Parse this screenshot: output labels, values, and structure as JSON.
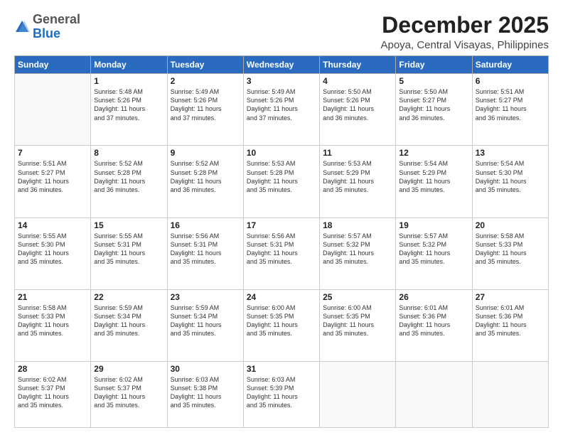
{
  "logo": {
    "general": "General",
    "blue": "Blue"
  },
  "title": "December 2025",
  "location": "Apoya, Central Visayas, Philippines",
  "days_header": [
    "Sunday",
    "Monday",
    "Tuesday",
    "Wednesday",
    "Thursday",
    "Friday",
    "Saturday"
  ],
  "weeks": [
    [
      {
        "day": "",
        "info": ""
      },
      {
        "day": "1",
        "info": "Sunrise: 5:48 AM\nSunset: 5:26 PM\nDaylight: 11 hours\nand 37 minutes."
      },
      {
        "day": "2",
        "info": "Sunrise: 5:49 AM\nSunset: 5:26 PM\nDaylight: 11 hours\nand 37 minutes."
      },
      {
        "day": "3",
        "info": "Sunrise: 5:49 AM\nSunset: 5:26 PM\nDaylight: 11 hours\nand 37 minutes."
      },
      {
        "day": "4",
        "info": "Sunrise: 5:50 AM\nSunset: 5:26 PM\nDaylight: 11 hours\nand 36 minutes."
      },
      {
        "day": "5",
        "info": "Sunrise: 5:50 AM\nSunset: 5:27 PM\nDaylight: 11 hours\nand 36 minutes."
      },
      {
        "day": "6",
        "info": "Sunrise: 5:51 AM\nSunset: 5:27 PM\nDaylight: 11 hours\nand 36 minutes."
      }
    ],
    [
      {
        "day": "7",
        "info": "Sunrise: 5:51 AM\nSunset: 5:27 PM\nDaylight: 11 hours\nand 36 minutes."
      },
      {
        "day": "8",
        "info": "Sunrise: 5:52 AM\nSunset: 5:28 PM\nDaylight: 11 hours\nand 36 minutes."
      },
      {
        "day": "9",
        "info": "Sunrise: 5:52 AM\nSunset: 5:28 PM\nDaylight: 11 hours\nand 36 minutes."
      },
      {
        "day": "10",
        "info": "Sunrise: 5:53 AM\nSunset: 5:28 PM\nDaylight: 11 hours\nand 35 minutes."
      },
      {
        "day": "11",
        "info": "Sunrise: 5:53 AM\nSunset: 5:29 PM\nDaylight: 11 hours\nand 35 minutes."
      },
      {
        "day": "12",
        "info": "Sunrise: 5:54 AM\nSunset: 5:29 PM\nDaylight: 11 hours\nand 35 minutes."
      },
      {
        "day": "13",
        "info": "Sunrise: 5:54 AM\nSunset: 5:30 PM\nDaylight: 11 hours\nand 35 minutes."
      }
    ],
    [
      {
        "day": "14",
        "info": "Sunrise: 5:55 AM\nSunset: 5:30 PM\nDaylight: 11 hours\nand 35 minutes."
      },
      {
        "day": "15",
        "info": "Sunrise: 5:55 AM\nSunset: 5:31 PM\nDaylight: 11 hours\nand 35 minutes."
      },
      {
        "day": "16",
        "info": "Sunrise: 5:56 AM\nSunset: 5:31 PM\nDaylight: 11 hours\nand 35 minutes."
      },
      {
        "day": "17",
        "info": "Sunrise: 5:56 AM\nSunset: 5:31 PM\nDaylight: 11 hours\nand 35 minutes."
      },
      {
        "day": "18",
        "info": "Sunrise: 5:57 AM\nSunset: 5:32 PM\nDaylight: 11 hours\nand 35 minutes."
      },
      {
        "day": "19",
        "info": "Sunrise: 5:57 AM\nSunset: 5:32 PM\nDaylight: 11 hours\nand 35 minutes."
      },
      {
        "day": "20",
        "info": "Sunrise: 5:58 AM\nSunset: 5:33 PM\nDaylight: 11 hours\nand 35 minutes."
      }
    ],
    [
      {
        "day": "21",
        "info": "Sunrise: 5:58 AM\nSunset: 5:33 PM\nDaylight: 11 hours\nand 35 minutes."
      },
      {
        "day": "22",
        "info": "Sunrise: 5:59 AM\nSunset: 5:34 PM\nDaylight: 11 hours\nand 35 minutes."
      },
      {
        "day": "23",
        "info": "Sunrise: 5:59 AM\nSunset: 5:34 PM\nDaylight: 11 hours\nand 35 minutes."
      },
      {
        "day": "24",
        "info": "Sunrise: 6:00 AM\nSunset: 5:35 PM\nDaylight: 11 hours\nand 35 minutes."
      },
      {
        "day": "25",
        "info": "Sunrise: 6:00 AM\nSunset: 5:35 PM\nDaylight: 11 hours\nand 35 minutes."
      },
      {
        "day": "26",
        "info": "Sunrise: 6:01 AM\nSunset: 5:36 PM\nDaylight: 11 hours\nand 35 minutes."
      },
      {
        "day": "27",
        "info": "Sunrise: 6:01 AM\nSunset: 5:36 PM\nDaylight: 11 hours\nand 35 minutes."
      }
    ],
    [
      {
        "day": "28",
        "info": "Sunrise: 6:02 AM\nSunset: 5:37 PM\nDaylight: 11 hours\nand 35 minutes."
      },
      {
        "day": "29",
        "info": "Sunrise: 6:02 AM\nSunset: 5:37 PM\nDaylight: 11 hours\nand 35 minutes."
      },
      {
        "day": "30",
        "info": "Sunrise: 6:03 AM\nSunset: 5:38 PM\nDaylight: 11 hours\nand 35 minutes."
      },
      {
        "day": "31",
        "info": "Sunrise: 6:03 AM\nSunset: 5:39 PM\nDaylight: 11 hours\nand 35 minutes."
      },
      {
        "day": "",
        "info": ""
      },
      {
        "day": "",
        "info": ""
      },
      {
        "day": "",
        "info": ""
      }
    ]
  ]
}
